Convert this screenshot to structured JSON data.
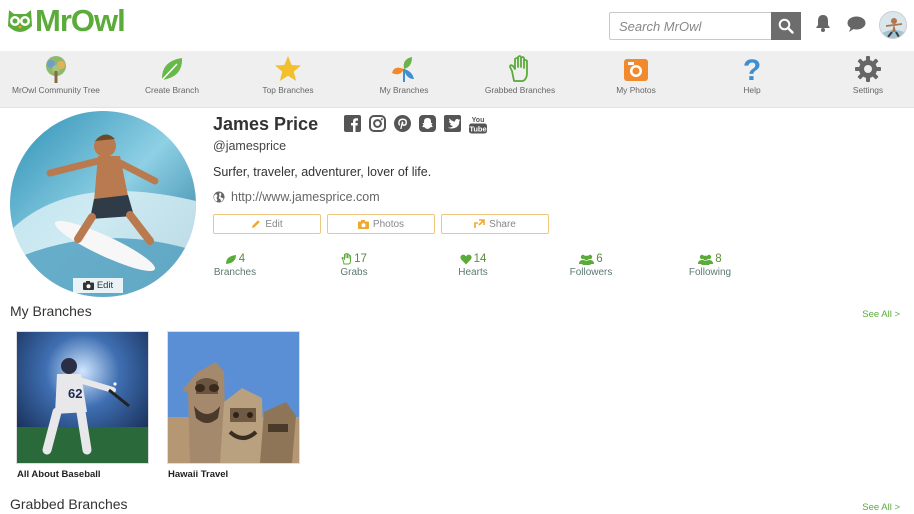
{
  "app": {
    "brand": "MrOwl",
    "search_placeholder": "Search MrOwl",
    "accent": "#5aab3a"
  },
  "nav": {
    "items": [
      {
        "label": "MrOwl Community Tree",
        "icon": "tree-icon"
      },
      {
        "label": "Create Branch",
        "icon": "leaf-icon"
      },
      {
        "label": "Top Branches",
        "icon": "star-icon"
      },
      {
        "label": "My Branches",
        "icon": "branches-icon"
      },
      {
        "label": "Grabbed Branches",
        "icon": "hand-icon"
      },
      {
        "label": "My Photos",
        "icon": "camera-icon"
      },
      {
        "label": "Help",
        "icon": "question-icon"
      },
      {
        "label": "Settings",
        "icon": "gear-icon"
      }
    ]
  },
  "profile": {
    "name": "James Price",
    "handle": "@jamesprice",
    "bio": "Surfer, traveler, adventurer, lover of life.",
    "website": "http://www.jamesprice.com",
    "photo_edit_label": "Edit",
    "buttons": {
      "edit": "Edit",
      "photos": "Photos",
      "share": "Share"
    },
    "socials": [
      "facebook-icon",
      "instagram-icon",
      "pinterest-icon",
      "snapchat-icon",
      "twitter-icon",
      "youtube-icon"
    ],
    "youtube_text": "You Tube"
  },
  "stats": [
    {
      "value": "4",
      "label": "Branches"
    },
    {
      "value": "17",
      "label": "Grabs"
    },
    {
      "value": "14",
      "label": "Hearts"
    },
    {
      "value": "6",
      "label": "Followers"
    },
    {
      "value": "8",
      "label": "Following"
    }
  ],
  "my_branches": {
    "title": "My Branches",
    "see_all": "See All >",
    "items": [
      {
        "caption": "All About Baseball",
        "player_number": "62"
      },
      {
        "caption": "Hawaii Travel"
      }
    ]
  },
  "grabbed_branches": {
    "title": "Grabbed Branches",
    "see_all": "See All >"
  }
}
